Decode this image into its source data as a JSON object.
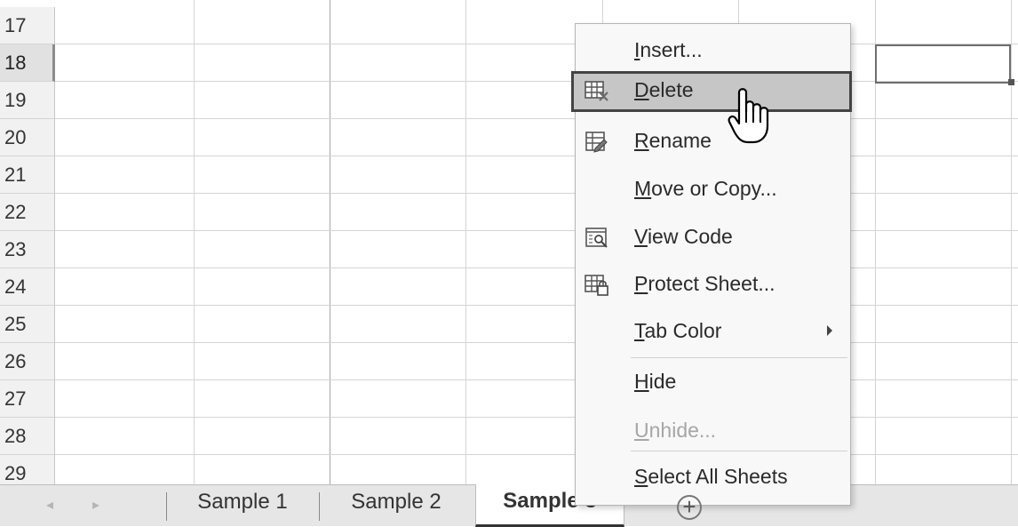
{
  "rows": [
    "17",
    "18",
    "19",
    "20",
    "21",
    "22",
    "23",
    "24",
    "25",
    "26",
    "27",
    "28",
    "29"
  ],
  "selected_row": "18",
  "sheet_tabs": {
    "nav_prev_icon": "triangle-left-icon",
    "nav_next_icon": "triangle-right-icon",
    "tabs": [
      {
        "label": "Sample 1",
        "active": false
      },
      {
        "label": "Sample 2",
        "active": false
      },
      {
        "label": "Sample 3",
        "active": true
      }
    ],
    "add_sheet_icon": "plus-circle-icon"
  },
  "context_menu": {
    "items": [
      {
        "pre": "",
        "u": "I",
        "post": "nsert...",
        "icon": "",
        "enabled": true
      },
      {
        "pre": "",
        "u": "D",
        "post": "elete",
        "icon": "delete-sheet-icon",
        "enabled": true,
        "hovered": true
      },
      {
        "pre": "",
        "u": "R",
        "post": "ename",
        "icon": "rename-sheet-icon",
        "enabled": true
      },
      {
        "pre": "",
        "u": "M",
        "post": "ove or Copy...",
        "icon": "",
        "enabled": true
      },
      {
        "pre": "",
        "u": "V",
        "post": "iew Code",
        "icon": "view-code-icon",
        "enabled": true
      },
      {
        "pre": "",
        "u": "P",
        "post": "rotect Sheet...",
        "icon": "protect-sheet-icon",
        "enabled": true
      },
      {
        "pre": "",
        "u": "T",
        "post": "ab Color",
        "icon": "",
        "enabled": true,
        "submenu": true
      },
      {
        "pre": "",
        "u": "H",
        "post": "ide",
        "icon": "",
        "enabled": true
      },
      {
        "pre": "",
        "u": "U",
        "post": "nhide...",
        "icon": "",
        "enabled": false
      },
      {
        "pre": "",
        "u": "S",
        "post": "elect All Sheets",
        "icon": "",
        "enabled": true
      }
    ]
  },
  "cursor_icon": "hand-pointer-icon",
  "colors": {
    "hover_bg": "#c6c6c6",
    "disabled_text": "#a6a6a6",
    "grid_line": "#d4d4d4"
  }
}
